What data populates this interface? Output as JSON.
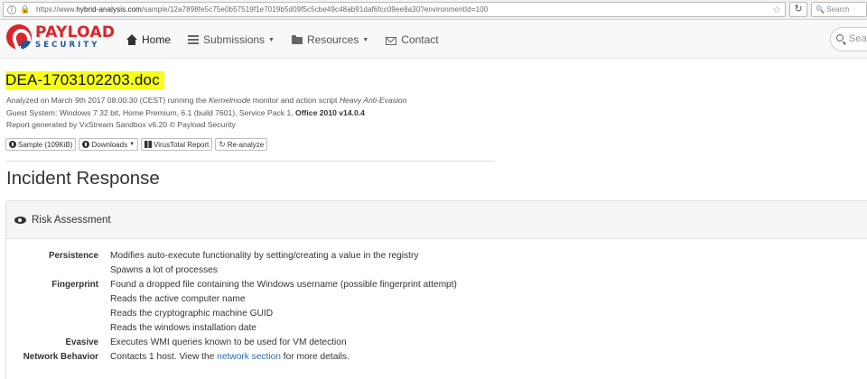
{
  "browser": {
    "url_prefix": "https://www.",
    "url_domain": "hybrid-analysis.com",
    "url_path": "/sample/12a7898fe5c75e0b57519f1e7019b5d09f5c5cbe49c48ab91daf6fcc09ee8a30?environmentId=100",
    "search_placeholder": "Search"
  },
  "site": {
    "logo_word": "PAYLOAD",
    "logo_sub": "SECURITY",
    "nav": [
      {
        "label": "Home"
      },
      {
        "label": "Submissions"
      },
      {
        "label": "Resources"
      },
      {
        "label": "Contact"
      }
    ],
    "search_placeholder": "Sear"
  },
  "sample": {
    "filename": "DEA-1703102203.doc",
    "analyzed_prefix": "Analyzed on March 9th 2017 08:00:30 (CEST) running the ",
    "monitor_mode": "Kernelmode",
    "analyzed_middle": " monitor and action script ",
    "action_script": "Heavy Anti-Evasion",
    "guest_system": "Guest System: Windows 7 32 bit, Home Premium, 6.1 (build 7601), Service Pack 1, ",
    "office_version": "Office 2010 v14.0.4",
    "report_generated": "Report generated by VxStream Sandbox v6.20 © Payload Security",
    "buttons": {
      "sample": "Sample (109KiB)",
      "downloads": "Downloads",
      "virustotal": "VirusTotal Report",
      "reanalyze": "Re-analyze"
    }
  },
  "incident": {
    "title": "Incident Response",
    "panel_title": "Risk Assessment",
    "persistence_label": "Persistence",
    "persistence_1": "Modifies auto-execute functionality by setting/creating a value in the registry",
    "persistence_2": "Spawns a lot of processes",
    "fingerprint_label": "Fingerprint",
    "fingerprint_1": "Found a dropped file containing the Windows username (possible fingerprint attempt)",
    "fingerprint_2": "Reads the active computer name",
    "fingerprint_3": "Reads the cryptographic machine GUID",
    "fingerprint_4": "Reads the windows installation date",
    "evasive_label": "Evasive",
    "evasive_1": "Executes WMI queries known to be used for VM detection",
    "network_label": "Network Behavior",
    "network_prefix": "Contacts 1 host. View the ",
    "network_link": "network section",
    "network_suffix": " for more details."
  }
}
